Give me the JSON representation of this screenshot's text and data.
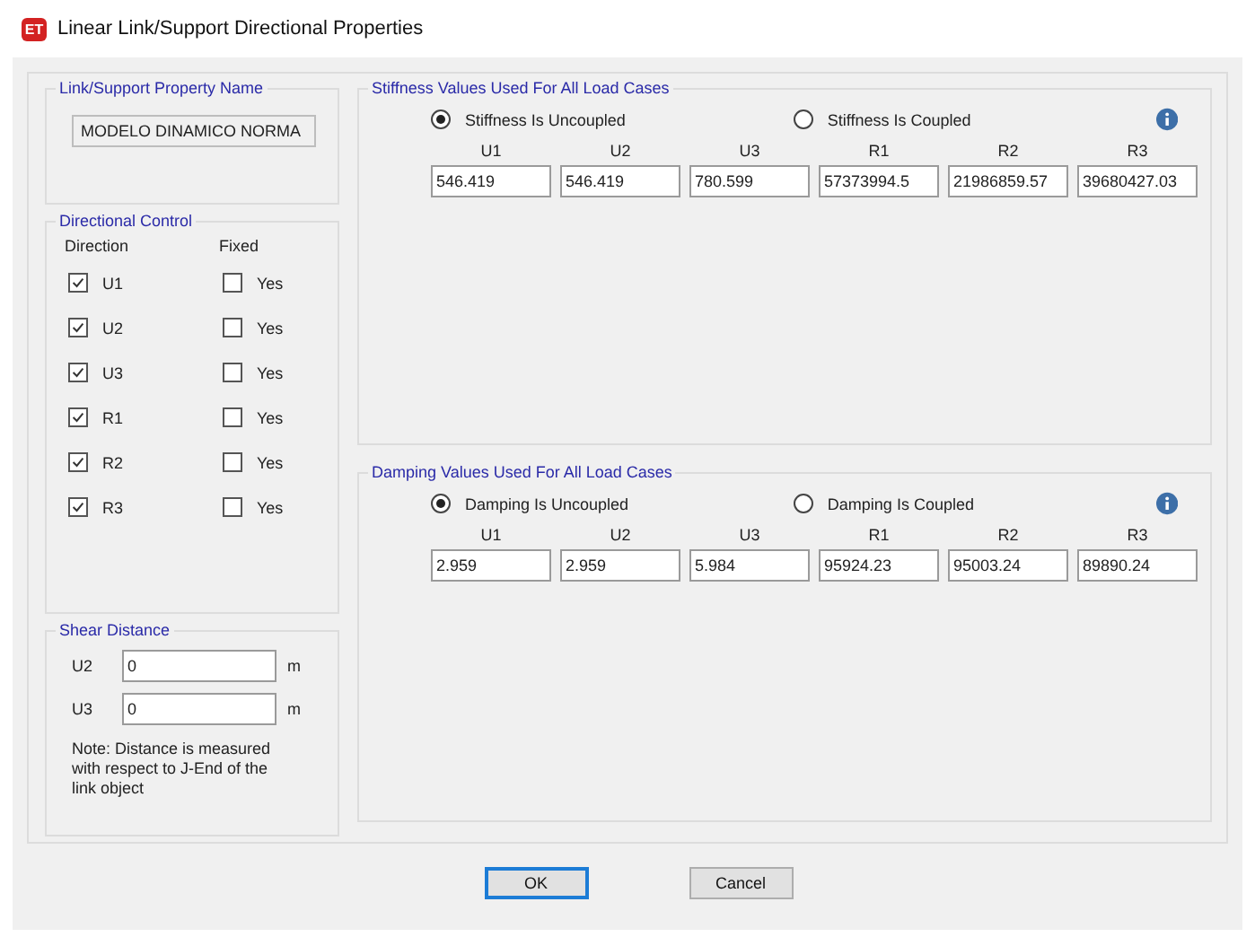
{
  "window": {
    "title": "Linear Link/Support Directional Properties",
    "icon": "ET"
  },
  "property_name": {
    "heading": "Link/Support Property Name",
    "value": "MODELO DINAMICO NORMA"
  },
  "directional_control": {
    "heading": "Directional Control",
    "direction_header": "Direction",
    "fixed_header": "Fixed",
    "rows": [
      {
        "direction": "U1",
        "checked": true,
        "fixed_label": "Yes",
        "fixed": false
      },
      {
        "direction": "U2",
        "checked": true,
        "fixed_label": "Yes",
        "fixed": false
      },
      {
        "direction": "U3",
        "checked": true,
        "fixed_label": "Yes",
        "fixed": false
      },
      {
        "direction": "R1",
        "checked": true,
        "fixed_label": "Yes",
        "fixed": false
      },
      {
        "direction": "R2",
        "checked": true,
        "fixed_label": "Yes",
        "fixed": false
      },
      {
        "direction": "R3",
        "checked": true,
        "fixed_label": "Yes",
        "fixed": false
      }
    ]
  },
  "shear_distance": {
    "heading": "Shear Distance",
    "fields": [
      {
        "label": "U2",
        "value": "0",
        "unit": "m"
      },
      {
        "label": "U3",
        "value": "0",
        "unit": "m"
      }
    ],
    "note": "Note: Distance is measured with respect to J-End of the link object"
  },
  "stiffness": {
    "heading": "Stiffness Values Used For All Load Cases",
    "options": [
      {
        "label": "Stiffness Is Uncoupled",
        "selected": true
      },
      {
        "label": "Stiffness Is Coupled",
        "selected": false
      }
    ],
    "columns": [
      {
        "label": "U1",
        "value": "546.419"
      },
      {
        "label": "U2",
        "value": "546.419"
      },
      {
        "label": "U3",
        "value": "780.599"
      },
      {
        "label": "R1",
        "value": "57373994.5"
      },
      {
        "label": "R2",
        "value": "21986859.57"
      },
      {
        "label": "R3",
        "value": "39680427.03"
      }
    ]
  },
  "damping": {
    "heading": "Damping Values Used For All Load Cases",
    "options": [
      {
        "label": "Damping Is Uncoupled",
        "selected": true
      },
      {
        "label": "Damping Is Coupled",
        "selected": false
      }
    ],
    "columns": [
      {
        "label": "U1",
        "value": "2.959"
      },
      {
        "label": "U2",
        "value": "2.959"
      },
      {
        "label": "U3",
        "value": "5.984"
      },
      {
        "label": "R1",
        "value": "95924.23"
      },
      {
        "label": "R2",
        "value": "95003.24"
      },
      {
        "label": "R3",
        "value": "89890.24"
      }
    ]
  },
  "buttons": [
    {
      "label": "OK",
      "default": true
    },
    {
      "label": "Cancel",
      "default": false
    }
  ]
}
